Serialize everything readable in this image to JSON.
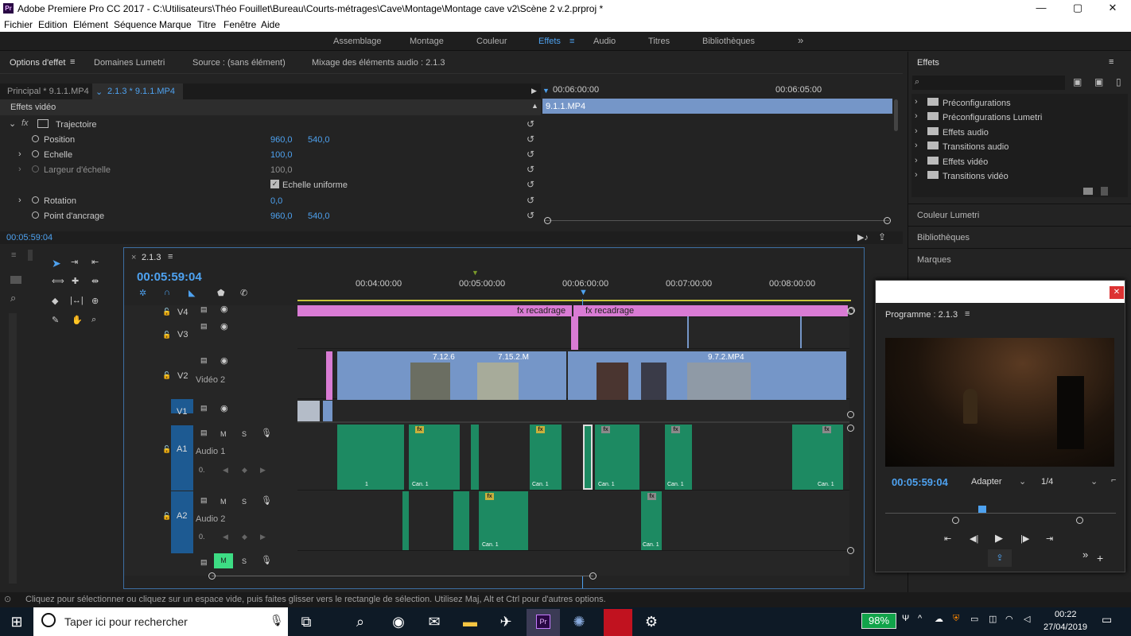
{
  "window": {
    "title": "Adobe Premiere Pro CC 2017 - C:\\Utilisateurs\\Théo Fouillet\\Bureau\\Courts-métrages\\Cave\\Montage\\Montage cave v2\\Scène 2 v.2.prproj *",
    "app_icon": "Pr",
    "minimize": "—",
    "maximize": "▢",
    "close": "✕"
  },
  "menu": [
    "Fichier",
    "Edition",
    "Elément",
    "Séquence",
    "Marque",
    "Titre",
    "Fenêtre",
    "Aide"
  ],
  "workspaces": [
    "Assemblage",
    "Montage",
    "Couleur",
    "Effets",
    "Audio",
    "Titres",
    "Bibliothèques"
  ],
  "workspaces_more": "»",
  "effect_controls": {
    "tabs": [
      "Options d'effet",
      "Domaines Lumetri",
      "Source : (sans élément)",
      "Mixage des éléments audio : 2.1.3"
    ],
    "master": "Principal * 9.1.1.MP4",
    "clip": "2.1.3 * 9.1.1.MP4",
    "section": "Effets vidéo",
    "effect": "Trajectoire",
    "props": [
      {
        "name": "Position",
        "v1": "960,0",
        "v2": "540,0"
      },
      {
        "name": "Echelle",
        "v1": "100,0",
        "v2": ""
      },
      {
        "name": "Largeur d'échelle",
        "v1": "100,0",
        "v2": ""
      },
      {
        "name": "Echelle uniforme",
        "v1": "",
        "v2": ""
      },
      {
        "name": "Rotation",
        "v1": "0,0",
        "v2": ""
      },
      {
        "name": "Point d'ancrage",
        "v1": "960,0",
        "v2": "540,0"
      }
    ],
    "time_a": "00:06:00:00",
    "time_b": "00:06:05:00",
    "clip_bar": "9.1.1.MP4",
    "timecode": "00:05:59:04"
  },
  "effects_panel": {
    "title": "Effets",
    "items": [
      "Préconfigurations",
      "Préconfigurations Lumetri",
      "Effets audio",
      "Transitions audio",
      "Effets vidéo",
      "Transitions vidéo"
    ],
    "collapsed": [
      "Couleur Lumetri",
      "Bibliothèques",
      "Marques"
    ]
  },
  "timeline": {
    "sequence": "2.1.3",
    "timecode": "00:05:59:04",
    "ruler": [
      "00:04:00:00",
      "00:05:00:00",
      "00:06:00:00",
      "00:07:00:00",
      "00:08:00:00"
    ],
    "tracks": {
      "v4": "V4",
      "v3": "V3",
      "v2": "V2",
      "v2_name": "Vidéo 2",
      "v1": "V1",
      "a1": "A1",
      "a1_name": "Audio 1",
      "a2": "A2",
      "a2_name": "Audio 2"
    },
    "m": "M",
    "s": "S",
    "fx_clip_1": "fx recadrage",
    "fx_clip_2": "fx recadrage",
    "clip_names": [
      "7.12.6",
      "7.15.2.M",
      "9.7.2.MP4"
    ],
    "can": "Can. 1",
    "one": "1",
    "vol": "0."
  },
  "program": {
    "title": "Programme : 2.1.3",
    "timecode": "00:05:59:04",
    "fit": "Adapter",
    "quality": "1/4"
  },
  "status": "Cliquez pour sélectionner ou cliquez sur un espace vide, puis faites glisser vers le rectangle de sélection. Utilisez Maj, Alt et Ctrl pour d'autres options.",
  "taskbar": {
    "search": "Taper ici pour rechercher",
    "battery": "98%",
    "time": "00:22",
    "date": "27/04/2019"
  }
}
